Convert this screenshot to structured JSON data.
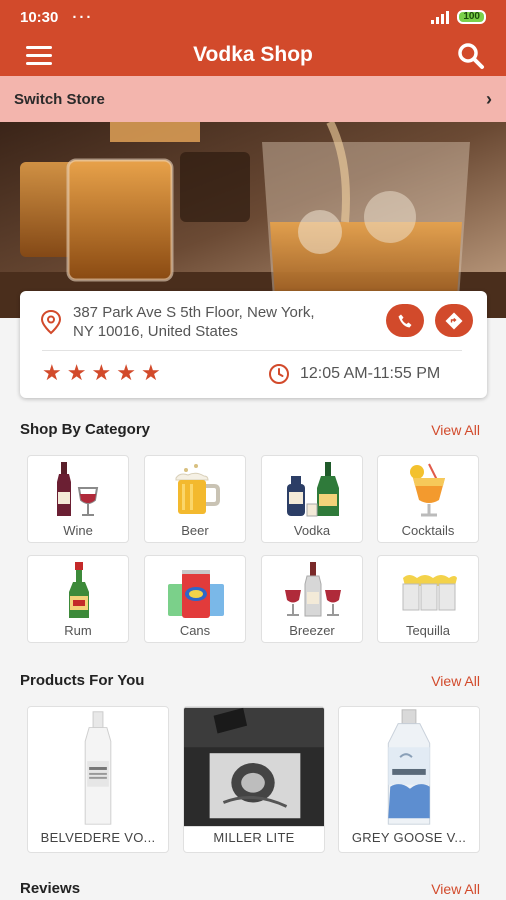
{
  "status_bar": {
    "time": "10:30",
    "dots": "···",
    "battery": "100"
  },
  "app_bar": {
    "title": "Vodka Shop"
  },
  "switch_store": {
    "label": "Switch Store",
    "chevron": "›"
  },
  "store": {
    "address_line1": "387 Park Ave S 5th Floor, New York,",
    "address_line2": "NY 10016, United States",
    "rating": 5,
    "hours": "12:05 AM-11:55 PM"
  },
  "categories": {
    "title": "Shop By Category",
    "view_all": "View All",
    "items": [
      {
        "label": "Wine",
        "icon": "wine-icon"
      },
      {
        "label": "Beer",
        "icon": "beer-icon"
      },
      {
        "label": "Vodka",
        "icon": "vodka-icon"
      },
      {
        "label": "Cocktails",
        "icon": "cocktail-icon"
      },
      {
        "label": "Rum",
        "icon": "rum-icon"
      },
      {
        "label": "Cans",
        "icon": "cans-icon"
      },
      {
        "label": "Breezer",
        "icon": "breezer-icon"
      },
      {
        "label": "Tequilla",
        "icon": "tequila-icon"
      }
    ]
  },
  "products": {
    "title": "Products For You",
    "view_all": "View All",
    "items": [
      {
        "name": "BELVEDERE VO..."
      },
      {
        "name": "MILLER LITE"
      },
      {
        "name": "GREY GOOSE V..."
      }
    ]
  },
  "reviews": {
    "title": "Reviews",
    "view_all": "View All"
  },
  "colors": {
    "primary": "#d24a2b",
    "switch_bg": "#f3b5ad",
    "page_bg": "#f4f4f4"
  }
}
